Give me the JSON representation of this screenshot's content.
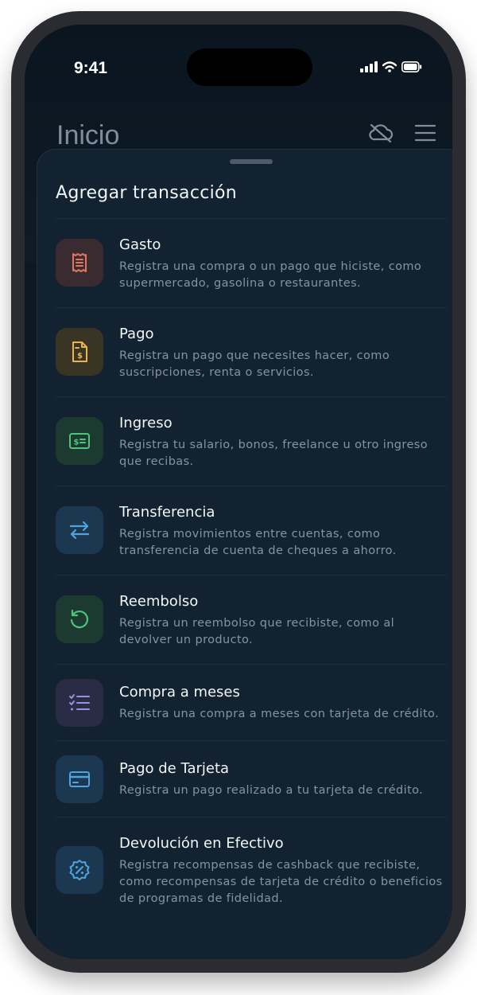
{
  "status_bar": {
    "time": "9:41"
  },
  "header": {
    "title": "Inicio"
  },
  "sheet": {
    "title": "Agregar transacción",
    "items": [
      {
        "title": "Gasto",
        "description": "Registra una compra o un pago que hiciste, como supermercado, gasolina o restaurantes.",
        "icon": "receipt-icon",
        "color": "#e07560"
      },
      {
        "title": "Pago",
        "description": "Registra un pago que necesites hacer, como suscripciones, renta o servicios.",
        "icon": "bill-icon",
        "color": "#e8b64f"
      },
      {
        "title": "Ingreso",
        "description": "Registra tu salario, bonos, freelance u otro ingreso que recibas.",
        "icon": "money-icon",
        "color": "#4fc37c"
      },
      {
        "title": "Transferencia",
        "description": "Registra movimientos entre cuentas, como transferencia de cuenta de cheques a ahorro.",
        "icon": "transfer-icon",
        "color": "#4ea5e0"
      },
      {
        "title": "Reembolso",
        "description": "Registra un reembolso que recibiste, como al devolver un producto.",
        "icon": "refund-icon",
        "color": "#4fc37c"
      },
      {
        "title": "Compra a meses",
        "description": "Registra una compra a meses con tarjeta de crédito.",
        "icon": "checklist-icon",
        "color": "#9b8fe0"
      },
      {
        "title": "Pago de Tarjeta",
        "description": "Registra un pago realizado a tu tarjeta de crédito.",
        "icon": "credit-card-icon",
        "color": "#4ea5e0"
      },
      {
        "title": "Devolución en Efectivo",
        "description": "Registra recompensas de cashback que recibiste, como recompensas de tarjeta de crédito o beneficios de programas de fidelidad.",
        "icon": "cashback-badge-icon",
        "color": "#4ea5e0"
      }
    ]
  }
}
